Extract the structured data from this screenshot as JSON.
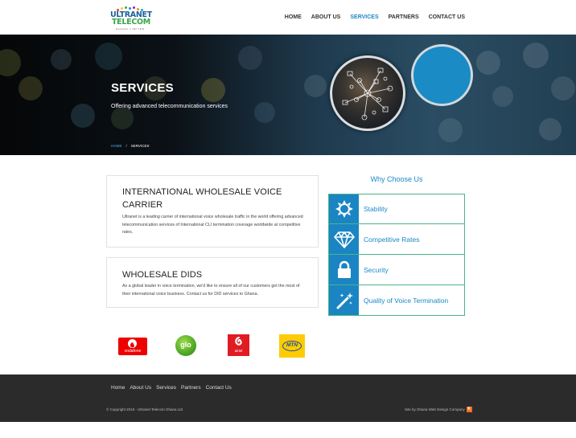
{
  "brand": {
    "line1": "ULTRANET",
    "line2": "TELECOM",
    "line3": "GHANA LIMITED"
  },
  "nav": {
    "items": [
      {
        "label": "HOME"
      },
      {
        "label": "ABOUT US"
      },
      {
        "label": "SERVICES",
        "active": true
      },
      {
        "label": "PARTNERS"
      },
      {
        "label": "CONTACT US"
      }
    ]
  },
  "hero": {
    "title": "SERVICES",
    "subtitle": "Offering advanced telecommunication services",
    "breadcrumb": {
      "home": "HOME",
      "separator": "/",
      "current": "SERVICES"
    }
  },
  "services": [
    {
      "title": "INTERNATIONAL WHOLESALE VOICE CARRIER",
      "text": "Ultranet is a leading carrier of international voice wholesale traffic in the world offering advanced telecommunication services of International CLI termination coverage worldwide at competitive rates."
    },
    {
      "title": "WHOLESALE DIDS",
      "text": "As a global leader in voice termination, we'd like to ensure all of our customers get the most of their international voice business. Contact us for DID services to Ghana."
    }
  ],
  "why": {
    "title": "Why Choose Us",
    "items": [
      {
        "label": "Stability",
        "icon": "sun-icon"
      },
      {
        "label": "Competitive Rates",
        "icon": "diamond-icon"
      },
      {
        "label": "Security",
        "icon": "lock-icon"
      },
      {
        "label": "Quality of Voice Termination",
        "icon": "magic-wand-icon"
      }
    ]
  },
  "partners": {
    "vodafone": "vodafone",
    "glo": "glo",
    "airtel": "airtel",
    "mtn": "MTN"
  },
  "footer": {
    "links": [
      "Home",
      "About Us",
      "Services",
      "Partners",
      "Contact Us"
    ],
    "copyright": "© Copyright 2018 - Ultranet Telecom Ghana Ltd",
    "credit": "Site by Ghana Web Design Company",
    "credit_mark": "K"
  },
  "colors": {
    "accent": "#1a88c9",
    "icon_bg": "#1a85c2",
    "border_green": "#4cb38a",
    "footer_bg": "#2b2b2b"
  }
}
